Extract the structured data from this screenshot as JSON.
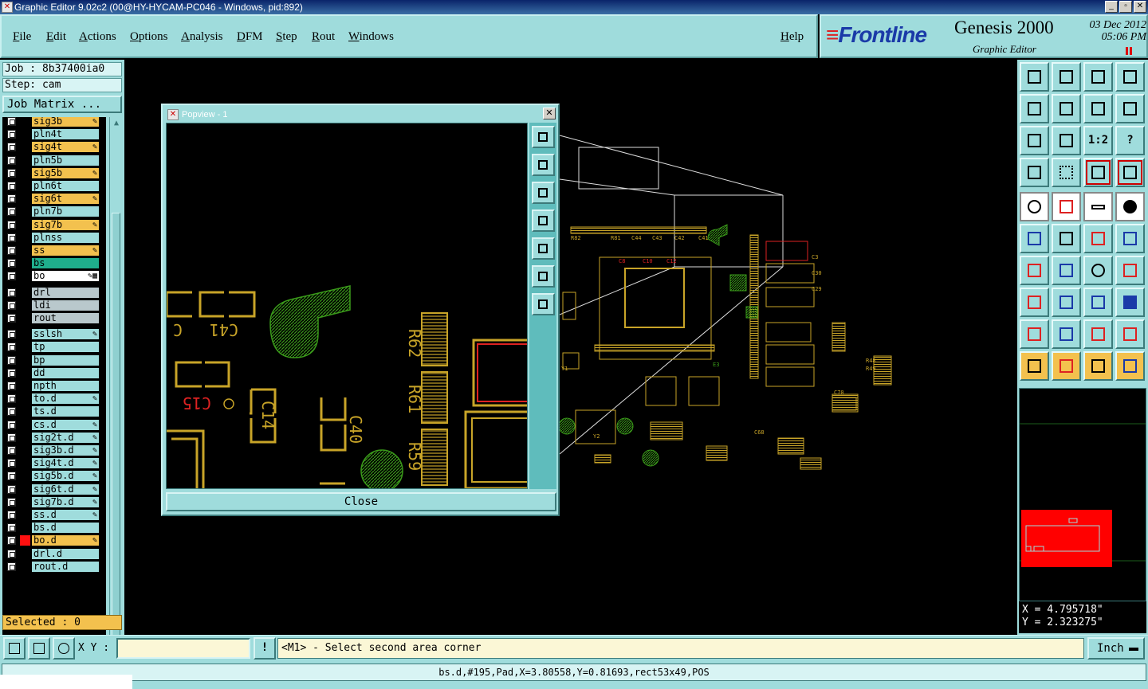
{
  "window": {
    "title": "Graphic Editor 9.02c2 (00@HY-HYCAM-PC046 - Windows, pid:892)"
  },
  "menu": [
    "File",
    "Edit",
    "Actions",
    "Options",
    "Analysis",
    "DFM",
    "Step",
    "Rout",
    "Windows"
  ],
  "help_label": "Help",
  "brand": {
    "logo": "Frontline",
    "product": "Genesis 2000",
    "subtitle": "Graphic Editor",
    "date": "03 Dec 2012",
    "time": "05:06 PM"
  },
  "job": {
    "job_text": "Job : 8b37400ia0",
    "step_text": "Step: cam",
    "matrix_button": "Job Matrix ..."
  },
  "layers": [
    {
      "name": "sig3b",
      "color": "#f3c14e",
      "mark": "✎"
    },
    {
      "name": "pln4t",
      "color": "#9fdcdc",
      "mark": ""
    },
    {
      "name": "sig4t",
      "color": "#f3c14e",
      "mark": "✎"
    },
    {
      "name": "pln5b",
      "color": "#9fdcdc",
      "mark": ""
    },
    {
      "name": "sig5b",
      "color": "#f3c14e",
      "mark": "✎"
    },
    {
      "name": "pln6t",
      "color": "#9fdcdc",
      "mark": ""
    },
    {
      "name": "sig6t",
      "color": "#f3c14e",
      "mark": "✎"
    },
    {
      "name": "pln7b",
      "color": "#9fdcdc",
      "mark": ""
    },
    {
      "name": "sig7b",
      "color": "#f3c14e",
      "mark": "✎"
    },
    {
      "name": "plnss",
      "color": "#9fdcdc",
      "mark": ""
    },
    {
      "name": "ss",
      "color": "#f3c14e",
      "mark": "✎"
    },
    {
      "name": "bs",
      "color": "#1fae8c",
      "mark": ""
    },
    {
      "name": "bo",
      "color": "#ffffff",
      "mark": "✎▦"
    },
    {
      "name": "drl",
      "color": "#b9c8cc",
      "mark": ""
    },
    {
      "name": "ldi",
      "color": "#b9c8cc",
      "mark": ""
    },
    {
      "name": "rout",
      "color": "#b9c8cc",
      "mark": ""
    },
    {
      "name": "sslsh",
      "color": "#9fdcdc",
      "mark": "✎"
    },
    {
      "name": "tp",
      "color": "#9fdcdc",
      "mark": ""
    },
    {
      "name": "bp",
      "color": "#9fdcdc",
      "mark": ""
    },
    {
      "name": "dd",
      "color": "#9fdcdc",
      "mark": ""
    },
    {
      "name": "npth",
      "color": "#9fdcdc",
      "mark": ""
    },
    {
      "name": "to.d",
      "color": "#9fdcdc",
      "mark": "✎"
    },
    {
      "name": "ts.d",
      "color": "#9fdcdc",
      "mark": ""
    },
    {
      "name": "cs.d",
      "color": "#9fdcdc",
      "mark": "✎"
    },
    {
      "name": "sig2t.d",
      "color": "#9fdcdc",
      "mark": "✎"
    },
    {
      "name": "sig3b.d",
      "color": "#9fdcdc",
      "mark": "✎"
    },
    {
      "name": "sig4t.d",
      "color": "#9fdcdc",
      "mark": "✎"
    },
    {
      "name": "sig5b.d",
      "color": "#9fdcdc",
      "mark": "✎"
    },
    {
      "name": "sig6t.d",
      "color": "#9fdcdc",
      "mark": "✎"
    },
    {
      "name": "sig7b.d",
      "color": "#9fdcdc",
      "mark": "✎"
    },
    {
      "name": "ss.d",
      "color": "#9fdcdc",
      "mark": "✎"
    },
    {
      "name": "bs.d",
      "color": "#9fdcdc",
      "mark": ""
    },
    {
      "name": "bo.d",
      "color": "#f3c14e",
      "mark": "✎"
    },
    {
      "name": "drl.d",
      "color": "#9fdcdc",
      "mark": ""
    },
    {
      "name": "rout.d",
      "color": "#9fdcdc",
      "mark": ""
    }
  ],
  "selected_text": "Selected : 0",
  "popview": {
    "title": "Popview - 1",
    "close_label": "Close",
    "labels": [
      "C41",
      "C",
      "C15",
      "C14",
      "C40",
      "R62",
      "R61",
      "R59"
    ]
  },
  "toolbar_texts": {
    "ratio": "1:2",
    "question": "?"
  },
  "coords": {
    "x_text": "X =  4.795718\"",
    "y_text": "Y =  2.323275\""
  },
  "bottom": {
    "xy_label": "X Y :",
    "xy_value": "",
    "bang": "!",
    "prompt": "<M1> - Select second area corner",
    "units": "Inch"
  },
  "status": "bs.d,#195,Pad,X=3.80558,Y=0.81693,rect53x49,POS",
  "colors": {
    "panel": "#9fdcdc",
    "accent_orange": "#f3c14e",
    "pcb_copper": "#c8a428",
    "pcb_green": "#3a9a1a",
    "pad_red": "#d22"
  }
}
